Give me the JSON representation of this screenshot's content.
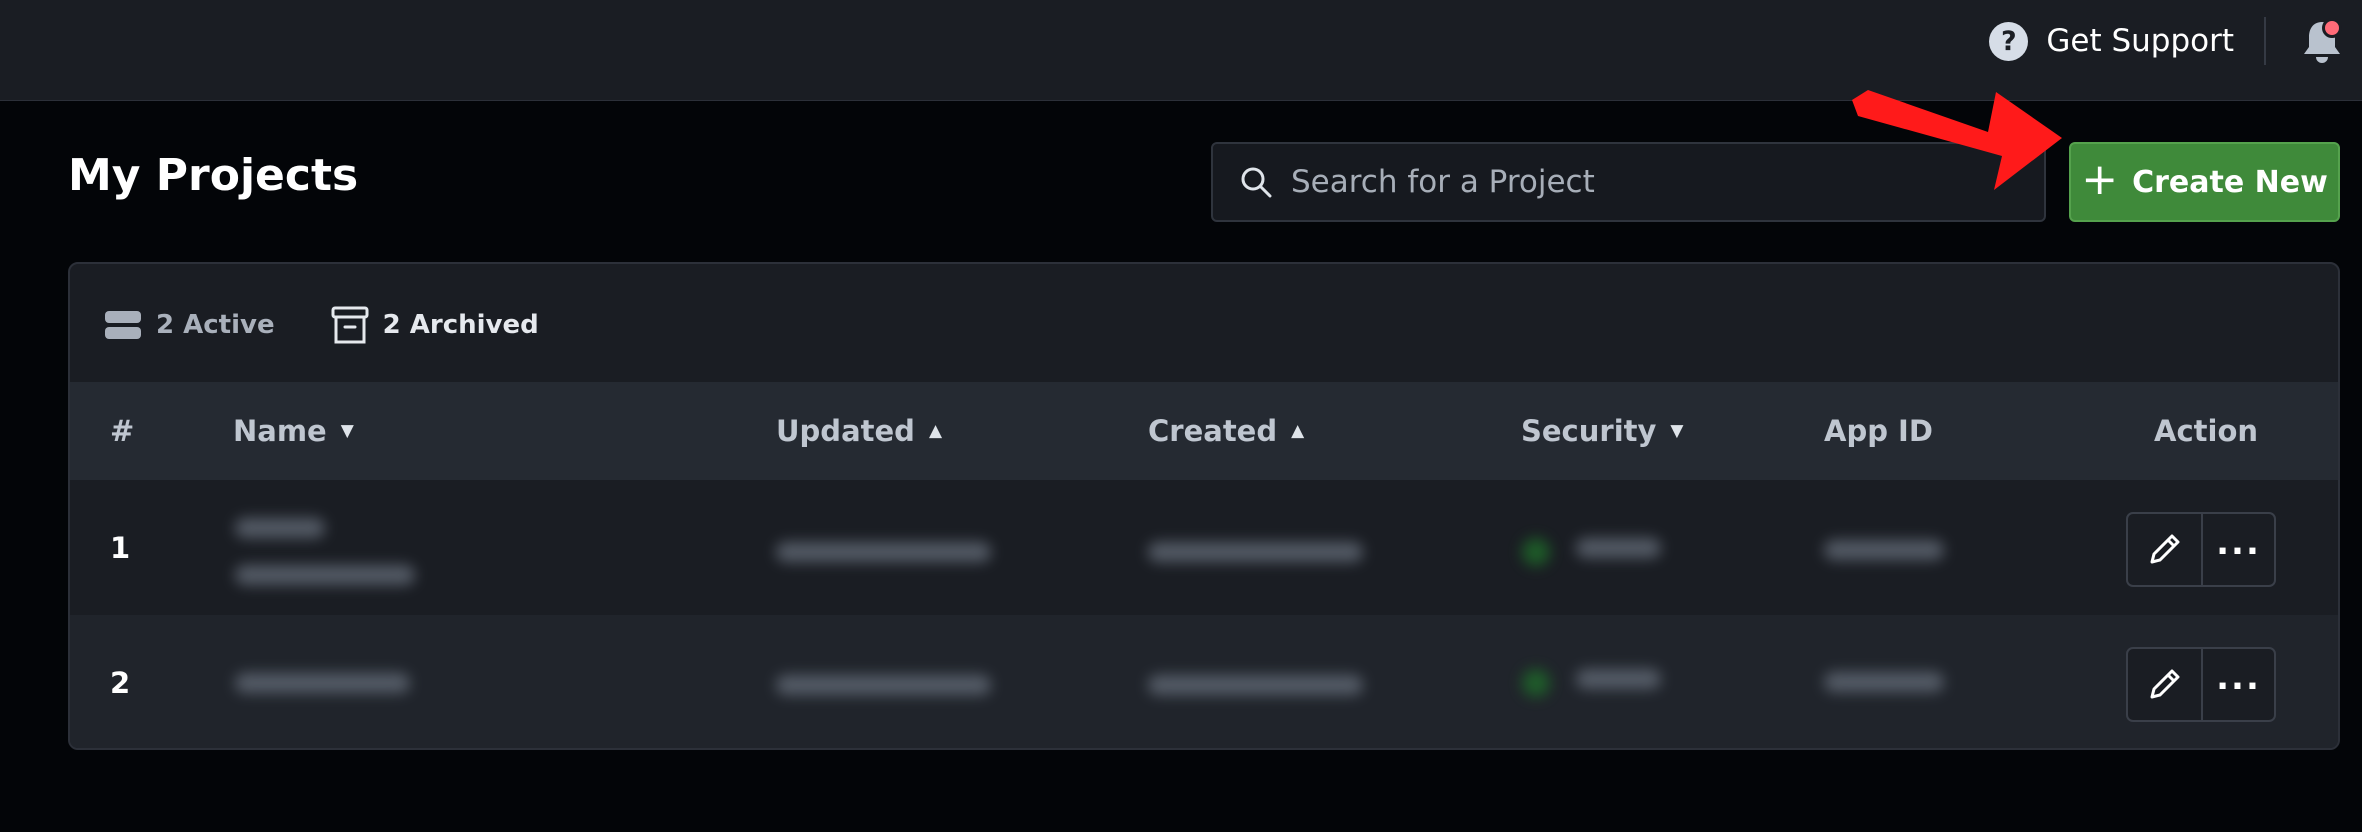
{
  "header": {
    "support_label": "Get Support",
    "help_icon": "question-circle-icon",
    "bell_icon": "bell-icon",
    "notification_color": "#ff6b78"
  },
  "page": {
    "title": "My Projects"
  },
  "search": {
    "placeholder": "Search for a Project",
    "value": "",
    "icon": "search-icon"
  },
  "create_button": {
    "label": "Create New",
    "icon": "plus-icon",
    "color": "#3f8a3a"
  },
  "filters": {
    "active_label": "2 Active",
    "archived_label": "2 Archived"
  },
  "table": {
    "columns": [
      {
        "label": "#",
        "sort": "none"
      },
      {
        "label": "Name",
        "sort": "down"
      },
      {
        "label": "Updated",
        "sort": "up"
      },
      {
        "label": "Created",
        "sort": "up"
      },
      {
        "label": "Security",
        "sort": "down"
      },
      {
        "label": "App ID",
        "sort": "none"
      },
      {
        "label": "Action",
        "sort": "none"
      }
    ],
    "rows": [
      {
        "number": "1"
      },
      {
        "number": "2"
      }
    ]
  },
  "annotation": {
    "arrow_color": "#ff1a1a"
  }
}
